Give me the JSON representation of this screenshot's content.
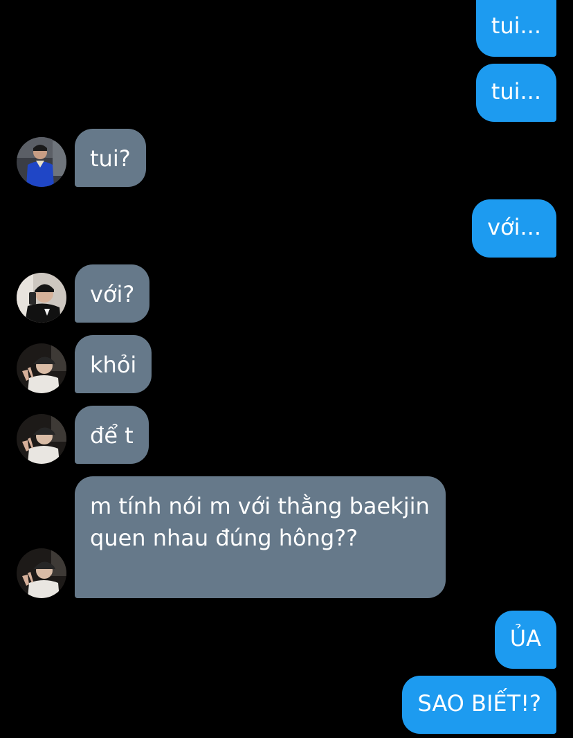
{
  "conversation": {
    "messages": [
      {
        "side": "out",
        "text": "tui..."
      },
      {
        "side": "out",
        "text": "tui..."
      },
      {
        "side": "in",
        "text": "tui?",
        "avatar": "avatar-blue-jacket"
      },
      {
        "side": "out",
        "text": "với..."
      },
      {
        "side": "in",
        "text": "với?",
        "avatar": "avatar-mirror-selfie"
      },
      {
        "side": "in",
        "text": "khỏi",
        "avatar": "avatar-cap-peace"
      },
      {
        "side": "in",
        "text": "để t",
        "avatar": "avatar-cap-peace"
      },
      {
        "side": "in",
        "text": "m tính nói m với thằng baekjin quen nhau đúng hông??",
        "avatar": "avatar-cap-peace"
      },
      {
        "side": "out",
        "text": "ỦA"
      },
      {
        "side": "out",
        "text": "SAO BIẾT!?"
      }
    ]
  },
  "colors": {
    "background": "#000000",
    "outgoing_bubble": "#1d9bf0",
    "incoming_bubble": "#66798a",
    "text": "#ffffff"
  }
}
